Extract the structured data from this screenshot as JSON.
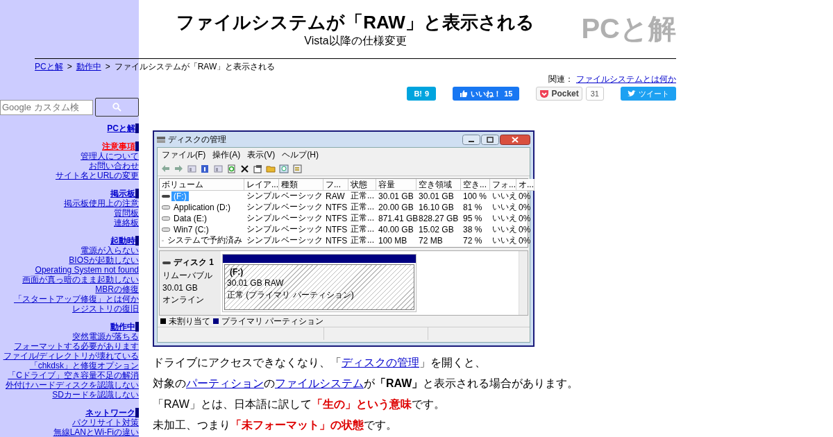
{
  "header": {
    "title": "ファイルシステムが「RAW」と表示される",
    "subtitle": "Vista以降の仕様変更",
    "logo": "PCと解"
  },
  "breadcrumb": [
    {
      "text": "PCと解",
      "kind": "link"
    },
    {
      "text": ">",
      "kind": "sep"
    },
    {
      "text": "動作中",
      "kind": "link"
    },
    {
      "text": ">",
      "kind": "sep"
    },
    {
      "text": "ファイルシステムが「RAW」と表示される",
      "kind": "text"
    }
  ],
  "related": {
    "label": "関連：",
    "link": "ファイルシステムとは何か"
  },
  "social": [
    {
      "kind": "hatena",
      "label": "B!",
      "count": "9"
    },
    {
      "kind": "facebook",
      "label": "いいね！",
      "count": "15"
    },
    {
      "kind": "pocket",
      "label": "Pocket",
      "count": "31"
    },
    {
      "kind": "twitter",
      "label": "ツイート"
    }
  ],
  "search": {
    "placeholder": "Google カスタム検"
  },
  "sidebar": [
    {
      "heading": "PCと解",
      "highlight": false
    },
    {
      "heading": "注意事項",
      "highlight": true,
      "links": [
        "管理人について",
        "お問い合わせ",
        "サイト名とURLの変更"
      ]
    },
    {
      "heading": "掲示板",
      "highlight": false,
      "links": [
        "掲示板使用上の注意",
        "質問板",
        "連絡板"
      ]
    },
    {
      "heading": "起動時",
      "highlight": false,
      "links": [
        "電源が入らない",
        "BIOSが起動しない",
        "Operating System not found",
        "画面が真っ暗のまま起動しない",
        "MBRの修復",
        "「スタートアップ修復」とは何か",
        "レジストリの復旧"
      ]
    },
    {
      "heading": "動作中",
      "highlight": false,
      "links": [
        "突然電源が落ちる",
        "フォーマットする必要があります",
        "ファイル/ディレクトリが壊れている",
        "「chkdsk」と修復オプション",
        "「Cドライブ」空き容量不足の解消",
        "外付けハードディスクを認識しない",
        "SDカードを認識しない"
      ]
    },
    {
      "heading": "ネットワーク",
      "highlight": false,
      "links": [
        "パクリサイト対策",
        "無線LANとWi-Fiの違い"
      ]
    }
  ],
  "window": {
    "title": "ディスクの管理",
    "menu": [
      "ファイル(F)",
      "操作(A)",
      "表示(V)",
      "ヘルプ(H)"
    ],
    "columns": [
      "ボリューム",
      "レイア...",
      "種類",
      "フ...",
      "状態",
      "容量",
      "空き領域",
      "空き...",
      "フォ...",
      "オ..."
    ],
    "rows": [
      {
        "kind": "removable",
        "selected": true,
        "cells": [
          "(F:)",
          "シンプル",
          "ベーシック",
          "RAW",
          "正常...",
          "30.01 GB",
          "30.01 GB",
          "100 %",
          "いいえ",
          "0%"
        ]
      },
      {
        "kind": "disk",
        "selected": false,
        "cells": [
          "Application (D:)",
          "シンプル",
          "ベーシック",
          "NTFS",
          "正常...",
          "20.00 GB",
          "16.10 GB",
          "81 %",
          "いいえ",
          "0%"
        ]
      },
      {
        "kind": "disk",
        "selected": false,
        "cells": [
          "Data (E:)",
          "シンプル",
          "ベーシック",
          "NTFS",
          "正常...",
          "871.41 GB",
          "828.27 GB",
          "95 %",
          "いいえ",
          "0%"
        ]
      },
      {
        "kind": "disk",
        "selected": false,
        "cells": [
          "Win7 (C:)",
          "シンプル",
          "ベーシック",
          "NTFS",
          "正常...",
          "40.00 GB",
          "15.02 GB",
          "38 %",
          "いいえ",
          "0%"
        ]
      },
      {
        "kind": "disk",
        "selected": false,
        "cells": [
          "システムで予約済み",
          "シンプル",
          "ベーシック",
          "NTFS",
          "正常...",
          "100 MB",
          "72 MB",
          "72 %",
          "いいえ",
          "0%"
        ]
      }
    ],
    "disk": {
      "name": "ディスク 1",
      "lines": [
        "リムーバブル",
        "30.01 GB",
        "オンライン"
      ]
    },
    "partition": {
      "name": "(F:)",
      "lines": [
        "30.01 GB RAW",
        "正常 (プライマリ パーティション)"
      ]
    },
    "legend": [
      {
        "label": "未割り当て",
        "color": "#000000"
      },
      {
        "label": "プライマリ パーティション",
        "color": "#000080"
      }
    ]
  },
  "paragraphs": [
    [
      {
        "kind": "plain",
        "text": "ドライブにアクセスできなくなり、「"
      },
      {
        "kind": "link",
        "text": "ディスクの管理"
      },
      {
        "kind": "plain",
        "text": "」を開くと、"
      }
    ],
    [
      {
        "kind": "plain",
        "text": "対象の"
      },
      {
        "kind": "link",
        "text": "パーティション"
      },
      {
        "kind": "plain",
        "text": "の"
      },
      {
        "kind": "link",
        "text": "ファイルシステム"
      },
      {
        "kind": "plain",
        "text": "が"
      },
      {
        "kind": "bold",
        "text": "「RAW」"
      },
      {
        "kind": "plain",
        "text": "と表示される場合があります。"
      }
    ],
    [
      {
        "kind": "plain",
        "text": "「RAW」とは、日本語に訳して"
      },
      {
        "kind": "red",
        "text": "「生の」という意味"
      },
      {
        "kind": "plain",
        "text": "です。"
      }
    ],
    [
      {
        "kind": "plain",
        "text": "未加工、つまり"
      },
      {
        "kind": "red",
        "text": "「未フォーマット」の状態"
      },
      {
        "kind": "plain",
        "text": "です。"
      }
    ]
  ]
}
